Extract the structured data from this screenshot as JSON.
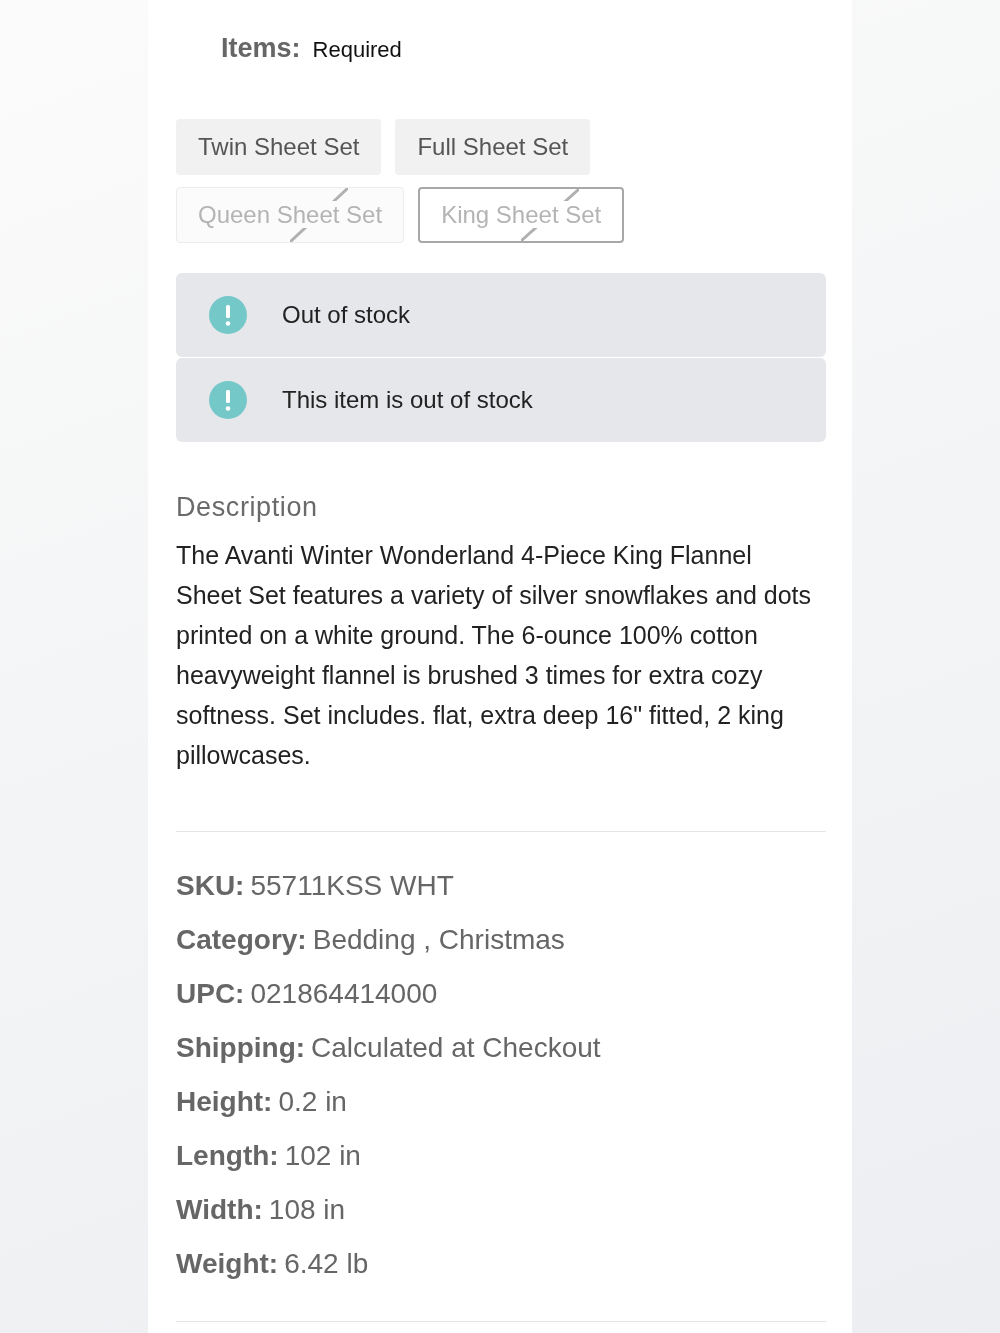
{
  "options_field": {
    "label": "Items:",
    "requirement": "Required"
  },
  "options": [
    {
      "label": "Twin Sheet Set",
      "available": true,
      "selected": false
    },
    {
      "label": "Full Sheet Set",
      "available": true,
      "selected": false
    },
    {
      "label": "Queen Sheet Set",
      "available": false,
      "selected": false
    },
    {
      "label": "King Sheet Set",
      "available": false,
      "selected": true
    }
  ],
  "alerts": [
    {
      "text": "Out of stock"
    },
    {
      "text": "This item is out of stock"
    }
  ],
  "description": {
    "heading": "Description",
    "text": "The Avanti Winter Wonderland 4-Piece King Flannel Sheet Set features a variety of silver snowflakes and dots printed on a white ground. The 6-ounce 100% cotton heavyweight flannel is brushed 3 times for extra cozy softness. Set includes. flat, extra deep 16\" fitted, 2 king pillowcases."
  },
  "specs": [
    {
      "label": "SKU:",
      "value": "55711KSS WHT"
    },
    {
      "label": "Category:",
      "value": "Bedding , Christmas"
    },
    {
      "label": "UPC:",
      "value": "021864414000"
    },
    {
      "label": "Shipping:",
      "value": "Calculated at Checkout"
    },
    {
      "label": "Height:",
      "value": "0.2 in"
    },
    {
      "label": "Length:",
      "value": "102 in"
    },
    {
      "label": "Width:",
      "value": "108 in"
    },
    {
      "label": "Weight:",
      "value": "6.42 lb"
    }
  ]
}
